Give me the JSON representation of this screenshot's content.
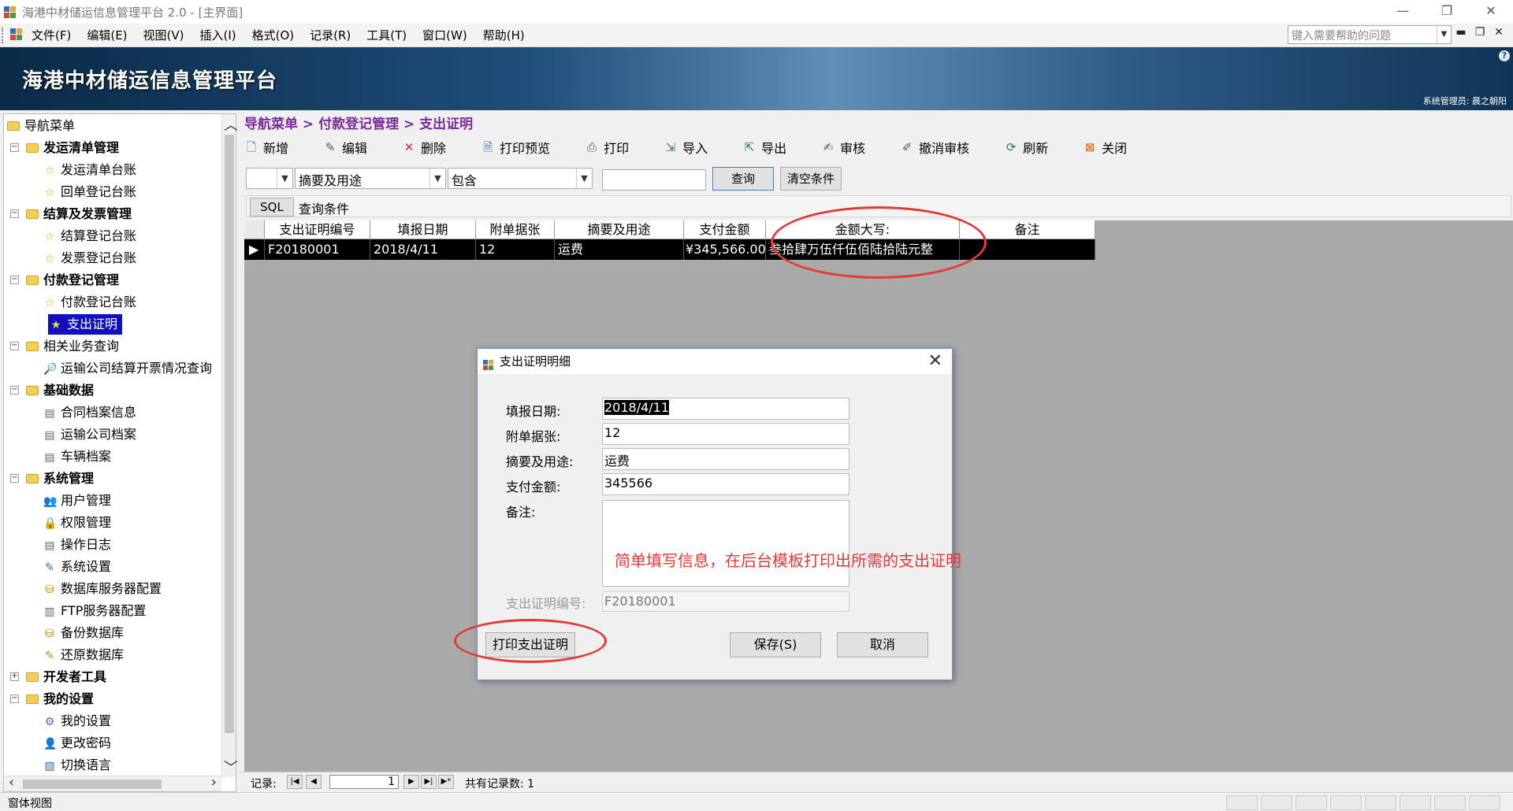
{
  "window": {
    "title": "海港中材储运信息管理平台 2.0 - [主界面]"
  },
  "menubar": {
    "items": [
      "文件(F)",
      "编辑(E)",
      "视图(V)",
      "插入(I)",
      "格式(O)",
      "记录(R)",
      "工具(T)",
      "窗口(W)",
      "帮助(H)"
    ],
    "help_placeholder": "键入需要帮助的问题"
  },
  "banner": {
    "title": "海港中材储运信息管理平台",
    "user": "系统管理员: 晨之朝阳"
  },
  "sidebar": {
    "root": "导航菜单",
    "groups": [
      {
        "label": "发运清单管理",
        "bold": true,
        "items": [
          "发运清单台账",
          "回单登记台账"
        ]
      },
      {
        "label": "结算及发票管理",
        "bold": true,
        "items": [
          "结算登记台账",
          "发票登记台账"
        ]
      },
      {
        "label": "付款登记管理",
        "bold": true,
        "items": [
          "付款登记台账",
          "支出证明"
        ]
      },
      {
        "label": "相关业务查询",
        "bold": false,
        "items": [
          "运输公司结算开票情况查询"
        ]
      },
      {
        "label": "基础数据",
        "bold": true,
        "items": [
          "合同档案信息",
          "运输公司档案",
          "车辆档案"
        ]
      },
      {
        "label": "系统管理",
        "bold": true,
        "items": [
          "用户管理",
          "权限管理",
          "操作日志",
          "系统设置",
          "数据库服务器配置",
          "FTP服务器配置",
          "备份数据库",
          "还原数据库"
        ]
      },
      {
        "label": "开发者工具",
        "bold": true,
        "items": []
      },
      {
        "label": "我的设置",
        "bold": true,
        "items": [
          "我的设置",
          "更改密码",
          "切换语言"
        ]
      }
    ],
    "selected": "支出证明"
  },
  "breadcrumb": "导航菜单 > 付款登记管理 > 支出证明",
  "toolbar": {
    "new": "新增",
    "edit": "编辑",
    "delete": "删除",
    "preview": "打印预览",
    "print": "打印",
    "import": "导入",
    "export": "导出",
    "audit": "审核",
    "unaudit": "撤消审核",
    "refresh": "刷新",
    "close": "关闭"
  },
  "filter": {
    "field": "摘要及用途",
    "operator": "包含",
    "value": "",
    "query_btn": "查询",
    "clear_btn": "清空条件"
  },
  "sqlbar": {
    "sql_btn": "SQL",
    "label": "查询条件"
  },
  "grid": {
    "columns": [
      "支出证明编号",
      "填报日期",
      "附单据张",
      "摘要及用途",
      "支付金额",
      "金额大写:",
      "备注"
    ],
    "rows": [
      [
        "F20180001",
        "2018/4/11",
        "12",
        "运费",
        "¥345,566.00",
        "叁拾肆万伍仟伍佰陆拾陆元整",
        ""
      ]
    ]
  },
  "navbar": {
    "label": "记录:",
    "current": "1",
    "total_label": "共有记录数: 1"
  },
  "statusbar": {
    "text": "窗体视图"
  },
  "dialog": {
    "title": "支出证明明细",
    "fields": {
      "date_label": "填报日期:",
      "date_value": "2018/4/11",
      "attach_label": "附单据张:",
      "attach_value": "12",
      "purpose_label": "摘要及用途:",
      "purpose_value": "运费",
      "amount_label": "支付金额:",
      "amount_value": "345566",
      "remark_label": "备注:",
      "remark_value": "",
      "code_label": "支出证明编号:",
      "code_value": "F20180001"
    },
    "print_btn": "打印支出证明",
    "save_btn": "保存(S)",
    "cancel_btn": "取消"
  },
  "annotation": {
    "text": "简单填写信息，在后台模板打印出所需的支出证明",
    "color": "#e53935"
  }
}
